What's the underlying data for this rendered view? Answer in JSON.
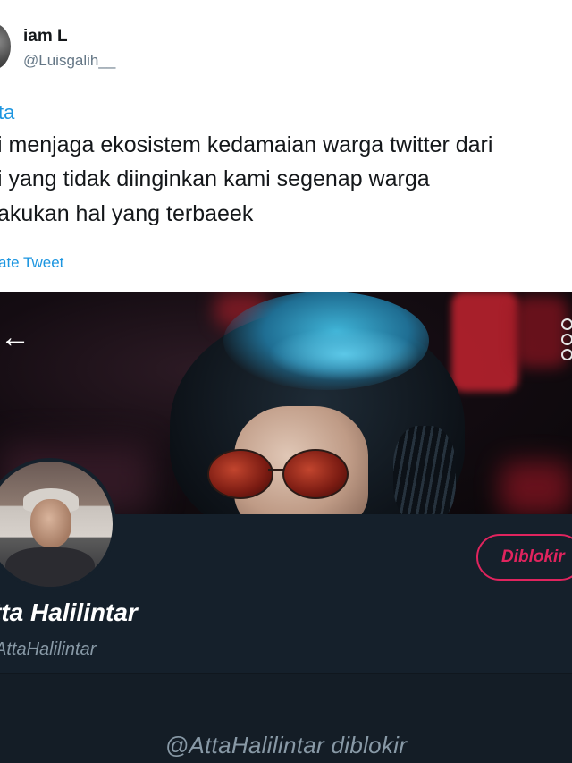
{
  "tweet": {
    "author_name": "iam L",
    "author_handle": "@Luisgalih__",
    "reply_to": "ta",
    "text_lines": [
      "i menjaga ekosistem kedamaian warga twitter dari",
      "i yang tidak diinginkan kami segenap warga",
      "akukan hal yang terbaeek"
    ],
    "translate_label": "ate Tweet"
  },
  "screenshot": {
    "back_icon": "arrow-left-icon",
    "more_icon": "more-vertical-icon",
    "blocked_button_label": "Diblokir",
    "profile_name": "tta Halilintar",
    "profile_handle": "AttaHalilintar",
    "blocked_message": "@AttaHalilintar diblokir",
    "colors": {
      "background": "#15202b",
      "accent_red": "#e0245e",
      "muted_text": "#8899a6",
      "link_blue": "#1b95e0"
    }
  }
}
